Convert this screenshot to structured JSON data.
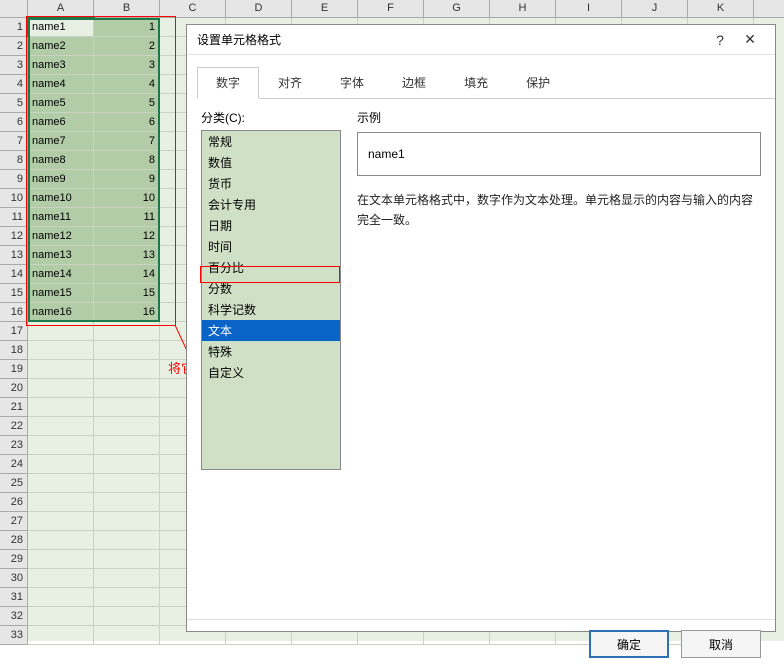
{
  "columns": [
    "A",
    "B",
    "C",
    "D",
    "E",
    "F",
    "G",
    "H",
    "I",
    "J",
    "K"
  ],
  "rowCount": 33,
  "data": {
    "A": [
      "name1",
      "name2",
      "name3",
      "name4",
      "name5",
      "name6",
      "name7",
      "name8",
      "name9",
      "name10",
      "name11",
      "name12",
      "name13",
      "name14",
      "name15",
      "name16"
    ],
    "B": [
      "1",
      "2",
      "3",
      "4",
      "5",
      "6",
      "7",
      "8",
      "9",
      "10",
      "11",
      "12",
      "13",
      "14",
      "15",
      "16"
    ]
  },
  "annotation": "将它们设置为文本",
  "dialog": {
    "title": "设置单元格格式",
    "help": "?",
    "close": "✕",
    "tabs": [
      "数字",
      "对齐",
      "字体",
      "边框",
      "填充",
      "保护"
    ],
    "activeTab": 0,
    "classifyLabel": "分类(C):",
    "categories": [
      "常规",
      "数值",
      "货币",
      "会计专用",
      "日期",
      "时间",
      "百分比",
      "分数",
      "科学记数",
      "文本",
      "特殊",
      "自定义"
    ],
    "selectedCategory": 9,
    "sampleLabel": "示例",
    "sampleValue": "name1",
    "description": "在文本单元格格式中，数字作为文本处理。单元格显示的内容与输入的内容完全一致。",
    "ok": "确定",
    "cancel": "取消"
  }
}
